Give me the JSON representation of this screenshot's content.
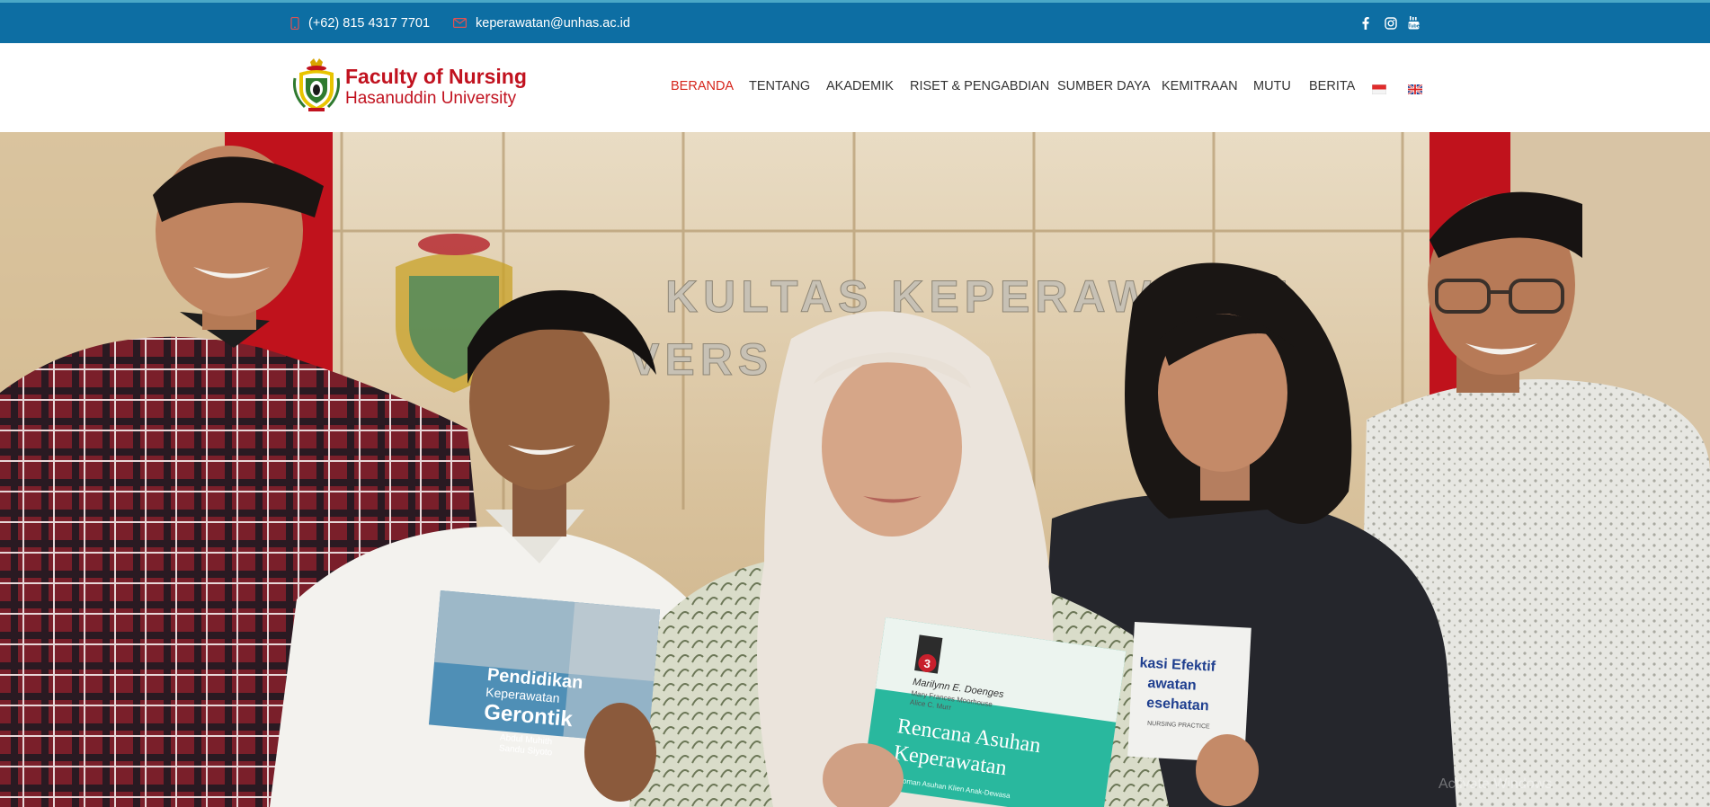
{
  "topbar": {
    "phone": "(+62) 815 4317 7701",
    "email": "keperawatan@unhas.ac.id",
    "phone_icon": "mobile-phone-icon",
    "email_icon": "envelope-icon",
    "social": [
      "facebook-icon",
      "instagram-icon",
      "youtube-icon"
    ]
  },
  "logo": {
    "title": "Faculty of Nursing",
    "subtitle": "Hasanuddin University",
    "emblem": "unhas-seal-logo"
  },
  "nav": {
    "items": [
      {
        "label": "BERANDA",
        "active": true
      },
      {
        "label": "TENTANG"
      },
      {
        "label": "AKADEMIK"
      },
      {
        "label": "RISET & PENGABDIAN"
      },
      {
        "label": "SUMBER DAYA"
      },
      {
        "label": "KEMITRAAN"
      },
      {
        "label": "MUTU"
      },
      {
        "label": "BERITA"
      }
    ],
    "languages": [
      "indonesia-flag-icon",
      "uk-flag-icon"
    ]
  },
  "hero": {
    "wall_sign_line1": "KULTAS KEPERAWATAN",
    "wall_sign_line2": "VERS   HASAN",
    "book1": {
      "title_line1": "Pendidikan",
      "title_line2": "Keperawatan",
      "title_line3": "Gerontik",
      "authors_line1": "Abdul Muhith",
      "authors_line2": "Sandu Siyoto"
    },
    "book2": {
      "edition": "3",
      "author": "Marilynn E. Doenges",
      "coauthors": "Mary Frances Moorhouse",
      "coauthors2": "Alice C. Murr",
      "title_line1": "Rencana Asuhan",
      "title_line2": "Keperawatan",
      "footer": "Pedoman Asuhan Klien Anak-Dewasa"
    },
    "book3": {
      "title_line1": "kasi Efektif",
      "title_line2": "awatan",
      "title_line3": "esehatan",
      "caption": "NURSING PRACTICE"
    },
    "watermark": "Activate Windows"
  },
  "colors": {
    "topbar": "#0d6ea3",
    "brand_red": "#c1121f",
    "nav_active": "#d6261c",
    "nav_text": "#333333"
  }
}
